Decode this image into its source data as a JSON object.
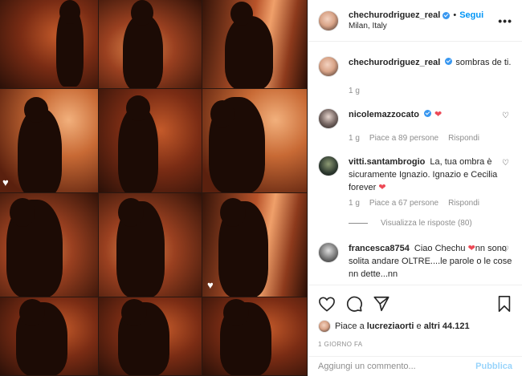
{
  "post": {
    "username": "chechurodriguez_real",
    "follow_label": "Segui",
    "separator": "•",
    "location": "Milan, Italy",
    "more_icon": "more-horizontal-icon",
    "caption_text": "sombras de ti.",
    "caption_time": "1 g"
  },
  "comments": [
    {
      "username": "nicolemazzocato",
      "verified": true,
      "text": "",
      "emoji": "❤",
      "time": "1 g",
      "likes": "Piace a 89 persone",
      "reply": "Rispondi"
    },
    {
      "username": "vitti.santambrogio",
      "text": "La, tua ombra è sicuramente Ignazio. Ignazio e Cecilia forever",
      "emoji": "❤",
      "time": "1 g",
      "likes": "Piace a 67 persone",
      "reply": "Rispondi",
      "view_replies": "Visualizza le risposte (80)"
    },
    {
      "username": "francesca8754",
      "text": "Ciao Chechu",
      "emoji": "❤",
      "text2": "nn sono solita andare OLTRE....le parole o le cose nn dette...nn"
    }
  ],
  "footer": {
    "likes_prefix": "Piace a",
    "liked_by": "lucreziaorti",
    "likes_mid": "e",
    "likes_others": "altri 44.121",
    "timestamp": "1 GIORNO FA",
    "comment_placeholder": "Aggiungi un commento...",
    "publish_label": "Pubblica"
  },
  "colors": {
    "accent": "#0095f6",
    "verified": "#3897f0",
    "heart": "#ed4956"
  }
}
